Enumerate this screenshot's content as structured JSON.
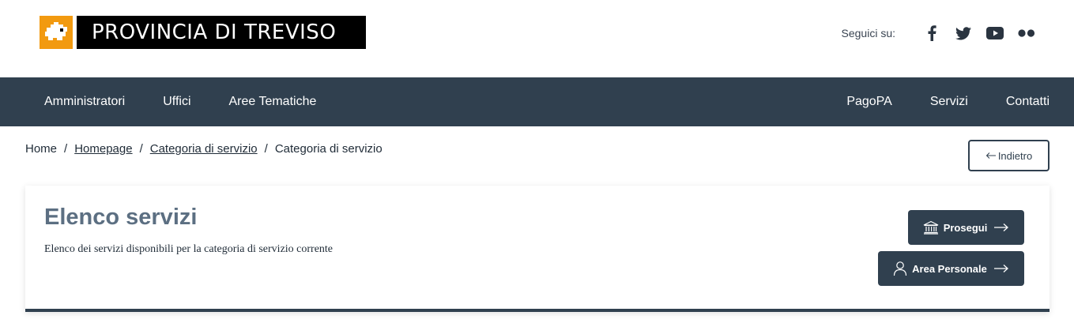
{
  "header": {
    "logo_icon": "treviso-province-map-icon",
    "title": "PROVINCIA DI TREVISO",
    "social_label": "Seguici su:",
    "social_icons": [
      "facebook-icon",
      "twitter-icon",
      "youtube-icon",
      "flickr-icon"
    ]
  },
  "nav": {
    "left": [
      "Amministratori",
      "Uffici",
      "Aree Tematiche"
    ],
    "right": [
      "PagoPA",
      "Servizi",
      "Contatti"
    ]
  },
  "breadcrumb": {
    "items": [
      "Home",
      "Homepage",
      "Categoria di servizio",
      "Categoria di servizio"
    ],
    "separator": "/"
  },
  "back_button": {
    "label": "Indietro",
    "icon": "arrow-left-icon"
  },
  "card": {
    "title": "Elenco servizi",
    "description": "Elenco dei servizi disponibili per la categoria di servizio corrente",
    "prosegui_label": "Prosegui",
    "prosegui_icon": "bank-building-icon",
    "area_label": "Area Personale",
    "area_icon": "user-icon"
  },
  "colors": {
    "primary_dark": "#30404f",
    "brand_orange": "#f29a10",
    "title_gray": "#5c6f82"
  }
}
